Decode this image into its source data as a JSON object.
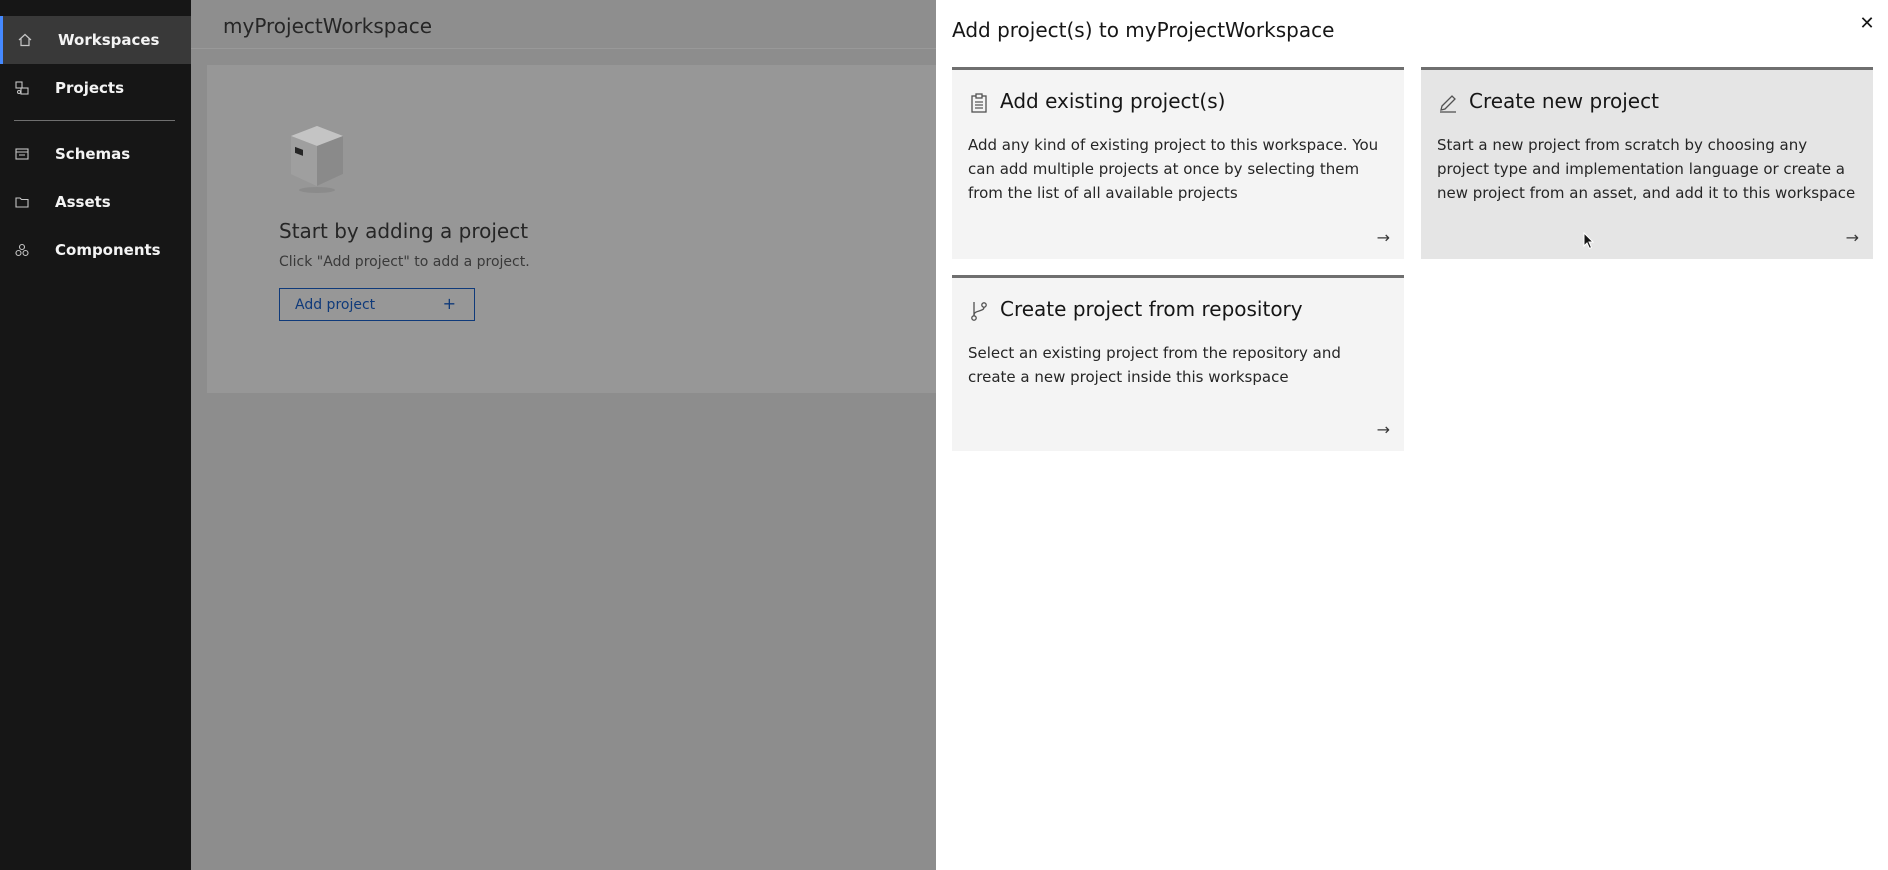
{
  "sidebar": {
    "items": [
      {
        "label": "Workspaces",
        "icon": "home-icon"
      },
      {
        "label": "Projects",
        "icon": "projects-icon"
      },
      {
        "label": "Schemas",
        "icon": "schemas-icon"
      },
      {
        "label": "Assets",
        "icon": "folder-icon"
      },
      {
        "label": "Components",
        "icon": "components-icon"
      }
    ]
  },
  "main": {
    "title": "myProjectWorkspace",
    "empty_state": {
      "title": "Start by adding a project",
      "subtitle": "Click \"Add project\" to add a project.",
      "button_label": "Add project",
      "button_icon": "+"
    }
  },
  "panel": {
    "title": "Add project(s) to myProjectWorkspace",
    "close_glyph": "✕",
    "tiles": [
      {
        "title": "Add existing project(s)",
        "description": "Add any kind of existing project to this workspace. You can add multiple projects at once by selecting them from the list of all available projects",
        "icon": "clipboard-icon",
        "arrow": "→"
      },
      {
        "title": "Create new project",
        "description": "Start a new project from scratch by choosing any project type and implementation language or create a new project from an asset, and add it to this workspace",
        "icon": "edit-icon",
        "arrow": "→"
      },
      {
        "title": "Create project from repository",
        "description": "Select an existing project from the repository and create a new project inside this workspace",
        "icon": "branch-icon",
        "arrow": "→"
      }
    ]
  },
  "colors": {
    "sidebar_bg": "#161616",
    "active_accent": "#4589ff",
    "overlay_bg": "#8d8d8d",
    "tile_bg": "#f4f4f4",
    "tile_border": "#6f6f6f"
  }
}
